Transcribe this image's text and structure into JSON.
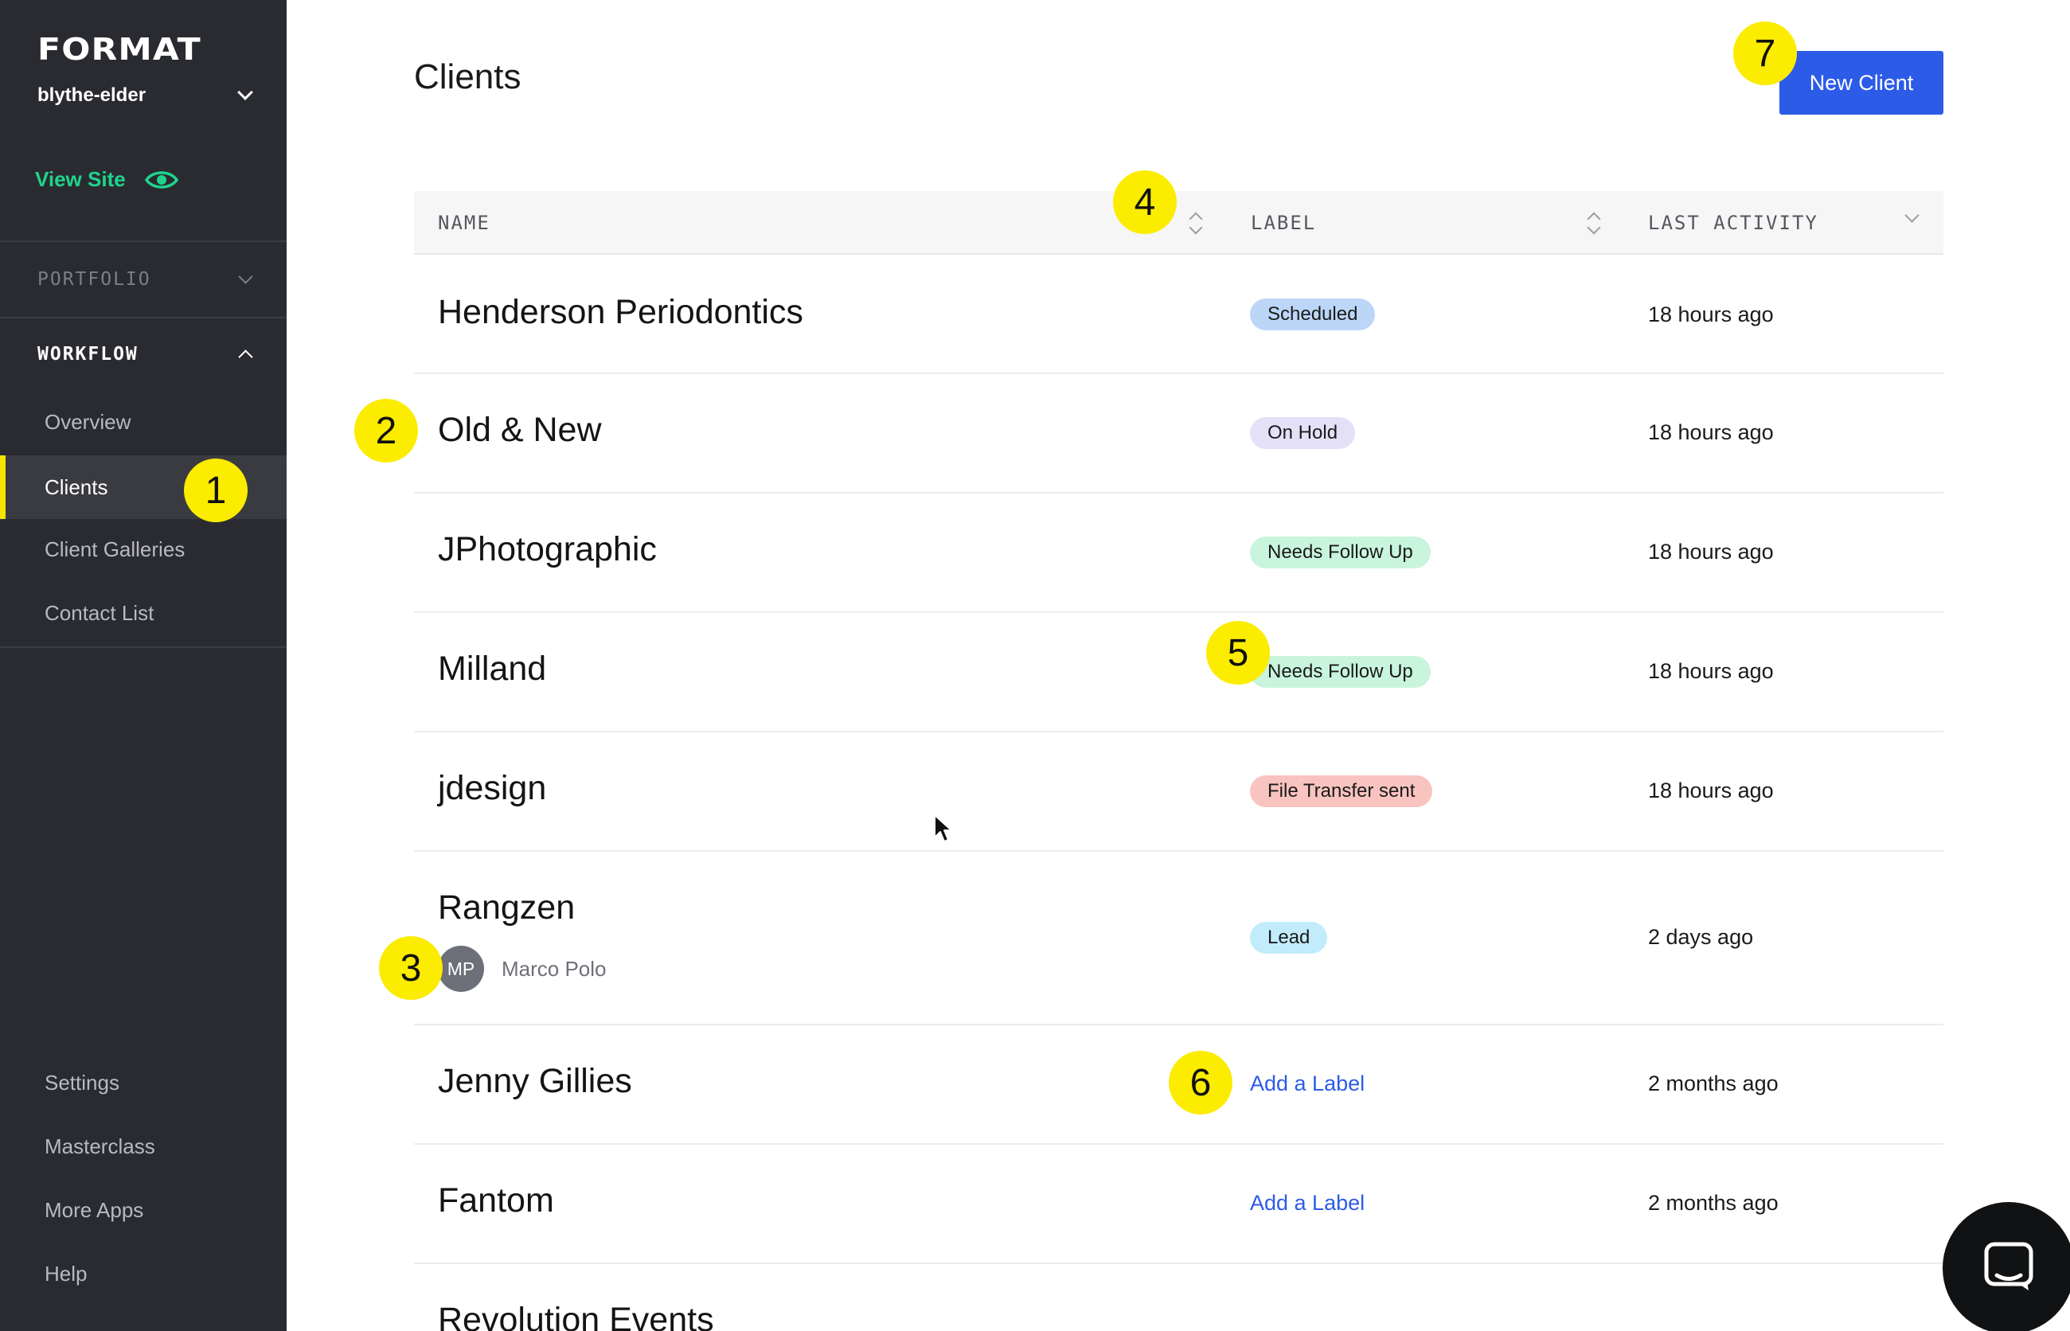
{
  "sidebar": {
    "logo": "FORMAT",
    "site_name": "blythe-elder",
    "view_site": "View Site",
    "sections": {
      "portfolio": "PORTFOLIO",
      "workflow": "WORKFLOW"
    },
    "workflow_items": [
      "Overview",
      "Clients",
      "Client Galleries",
      "Contact List"
    ],
    "selected_item": "Clients",
    "footer_items": [
      "Settings",
      "Masterclass",
      "More Apps",
      "Help"
    ]
  },
  "main": {
    "title": "Clients",
    "new_client_button": "New Client",
    "columns": {
      "name": "NAME",
      "label": "LABEL",
      "last_activity": "LAST ACTIVITY"
    },
    "rows": [
      {
        "name": "Henderson Periodontics",
        "label": "Scheduled",
        "activity": "18 hours ago"
      },
      {
        "name": "Old & New",
        "label": "On Hold",
        "activity": "18 hours ago"
      },
      {
        "name": "JPhotographic",
        "label": "Needs Follow Up",
        "activity": "18 hours ago"
      },
      {
        "name": "Milland",
        "label": "Needs Follow Up",
        "activity": "18 hours ago"
      },
      {
        "name": "jdesign",
        "label": "File Transfer sent",
        "activity": "18 hours ago"
      },
      {
        "name": "Rangzen",
        "label": "Lead",
        "activity": "2 days ago",
        "contact_initials": "MP",
        "contact_name": "Marco Polo"
      },
      {
        "name": "Jenny Gillies",
        "label": "Add a Label",
        "activity": "2 months ago"
      },
      {
        "name": "Fantom",
        "label": "Add a Label",
        "activity": "2 months ago"
      },
      {
        "name": "Revolution Events"
      }
    ]
  },
  "colors": {
    "sidebar_bg": "#2a2b30",
    "accent_yellow": "#f3e600",
    "view_site_green": "#1fd48e",
    "primary_blue": "#2c5be8",
    "badge_scheduled": "#bcd6f8",
    "badge_on_hold": "#e4e0f8",
    "badge_needs_follow_up": "#c8f5dc",
    "badge_file_transfer": "#f9c3c0",
    "badge_lead": "#c2ecfb"
  },
  "icons": {
    "site_switch": "chevron-down-icon",
    "view_site": "eye-icon",
    "sort": "sort-icon",
    "chat": "chat-icon"
  },
  "markers": [
    "1",
    "2",
    "3",
    "4",
    "5",
    "6",
    "7"
  ]
}
